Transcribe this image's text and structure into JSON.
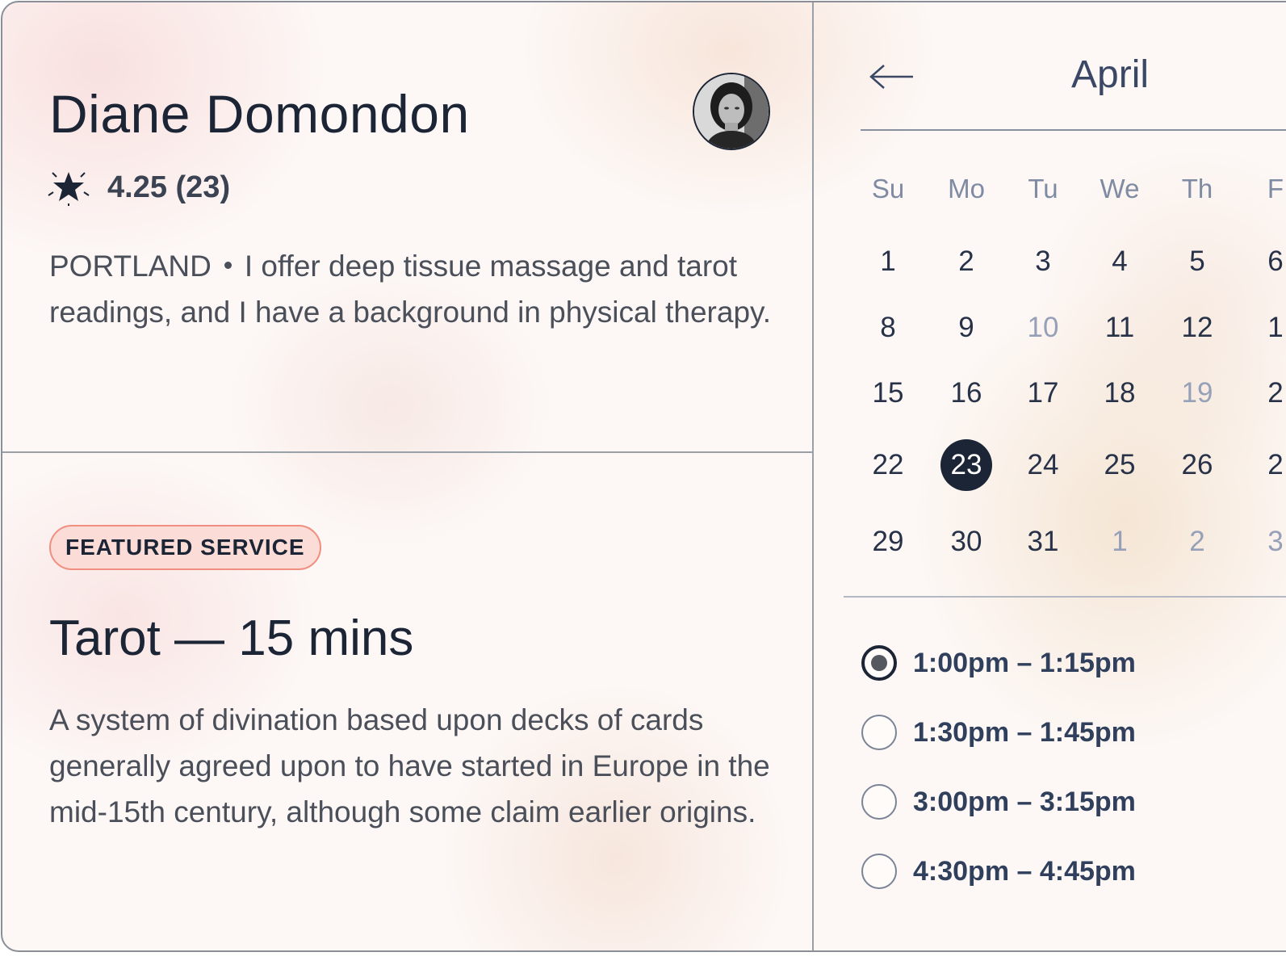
{
  "profile": {
    "name": "Diane Domondon",
    "rating": "4.25 (23)",
    "location": "PORTLAND",
    "bio": "I offer deep tissue massage and tarot readings, and I have a background in physical therapy."
  },
  "featured": {
    "badge": "FEATURED SERVICE",
    "title": "Tarot — 15 mins",
    "description": "A system of divination based upon decks of cards generally agreed upon to have started in Europe in the mid-15th century, although some claim earlier origins."
  },
  "calendar": {
    "month": "April",
    "weekdays": [
      "Su",
      "Mo",
      "Tu",
      "We",
      "Th",
      "F"
    ],
    "weeks": [
      [
        "1",
        "2",
        "3",
        "4",
        "5",
        "6"
      ],
      [
        "8",
        "9",
        "10",
        "11",
        "12",
        "1"
      ],
      [
        "15",
        "16",
        "17",
        "18",
        "19",
        "2"
      ],
      [
        "22",
        "23",
        "24",
        "25",
        "26",
        "2"
      ],
      [
        "29",
        "30",
        "31",
        "1",
        "2",
        "3"
      ]
    ],
    "selected": "23"
  },
  "slots": [
    {
      "label": "1:00pm – 1:15pm",
      "selected": true
    },
    {
      "label": "1:30pm – 1:45pm",
      "selected": false
    },
    {
      "label": "3:00pm – 3:15pm",
      "selected": false
    },
    {
      "label": "4:30pm – 4:45pm",
      "selected": false
    }
  ],
  "icons": {
    "back": "arrow-left-icon",
    "rating": "sparkle-star-icon"
  },
  "colors": {
    "ink": "#1c2535",
    "badge_fill": "#fbdcd7",
    "badge_border": "#f08e80",
    "accent_text": "#3a4865"
  }
}
